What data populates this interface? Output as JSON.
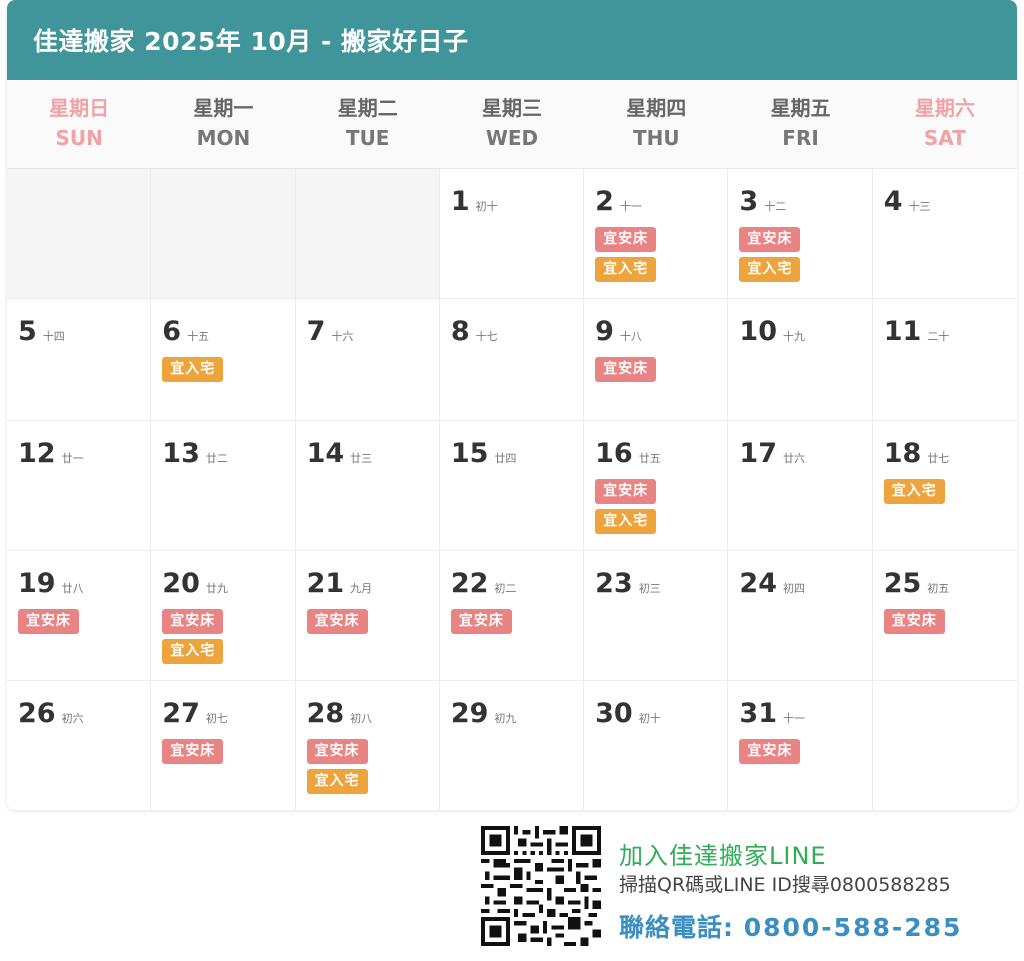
{
  "header": {
    "title": "佳達搬家 2025年 10月 - 搬家好日子"
  },
  "weekdays": [
    {
      "zh": "星期日",
      "en": "SUN",
      "weekend": true
    },
    {
      "zh": "星期一",
      "en": "MON",
      "weekend": false
    },
    {
      "zh": "星期二",
      "en": "TUE",
      "weekend": false
    },
    {
      "zh": "星期三",
      "en": "WED",
      "weekend": false
    },
    {
      "zh": "星期四",
      "en": "THU",
      "weekend": false
    },
    {
      "zh": "星期五",
      "en": "FRI",
      "weekend": false
    },
    {
      "zh": "星期六",
      "en": "SAT",
      "weekend": true
    }
  ],
  "tag_labels": {
    "bed": "宜安床",
    "move": "宜入宅"
  },
  "days": [
    {
      "num": "1",
      "lunar": "初十",
      "tags": []
    },
    {
      "num": "2",
      "lunar": "十一",
      "tags": [
        "bed",
        "move"
      ]
    },
    {
      "num": "3",
      "lunar": "十二",
      "tags": [
        "bed",
        "move"
      ]
    },
    {
      "num": "4",
      "lunar": "十三",
      "tags": []
    },
    {
      "num": "5",
      "lunar": "十四",
      "tags": []
    },
    {
      "num": "6",
      "lunar": "十五",
      "tags": [
        "move"
      ]
    },
    {
      "num": "7",
      "lunar": "十六",
      "tags": []
    },
    {
      "num": "8",
      "lunar": "十七",
      "tags": []
    },
    {
      "num": "9",
      "lunar": "十八",
      "tags": [
        "bed"
      ]
    },
    {
      "num": "10",
      "lunar": "十九",
      "tags": []
    },
    {
      "num": "11",
      "lunar": "二十",
      "tags": []
    },
    {
      "num": "12",
      "lunar": "廿一",
      "tags": []
    },
    {
      "num": "13",
      "lunar": "廿二",
      "tags": []
    },
    {
      "num": "14",
      "lunar": "廿三",
      "tags": []
    },
    {
      "num": "15",
      "lunar": "廿四",
      "tags": []
    },
    {
      "num": "16",
      "lunar": "廿五",
      "tags": [
        "bed",
        "move"
      ]
    },
    {
      "num": "17",
      "lunar": "廿六",
      "tags": []
    },
    {
      "num": "18",
      "lunar": "廿七",
      "tags": [
        "move"
      ]
    },
    {
      "num": "19",
      "lunar": "廿八",
      "tags": [
        "bed"
      ]
    },
    {
      "num": "20",
      "lunar": "廿九",
      "tags": [
        "bed",
        "move"
      ]
    },
    {
      "num": "21",
      "lunar": "九月",
      "tags": [
        "bed"
      ]
    },
    {
      "num": "22",
      "lunar": "初二",
      "tags": [
        "bed"
      ]
    },
    {
      "num": "23",
      "lunar": "初三",
      "tags": []
    },
    {
      "num": "24",
      "lunar": "初四",
      "tags": []
    },
    {
      "num": "25",
      "lunar": "初五",
      "tags": [
        "bed"
      ]
    },
    {
      "num": "26",
      "lunar": "初六",
      "tags": []
    },
    {
      "num": "27",
      "lunar": "初七",
      "tags": [
        "bed"
      ]
    },
    {
      "num": "28",
      "lunar": "初八",
      "tags": [
        "bed",
        "move"
      ]
    },
    {
      "num": "29",
      "lunar": "初九",
      "tags": []
    },
    {
      "num": "30",
      "lunar": "初十",
      "tags": []
    },
    {
      "num": "31",
      "lunar": "十一",
      "tags": [
        "bed"
      ]
    }
  ],
  "footer": {
    "line_title": "加入佳達搬家LINE",
    "line_sub": "掃描QR碼或LINE ID搜尋0800588285",
    "phone_label": "聯絡電話:",
    "phone_number": "0800-588-285",
    "qr_icon": "qr-code-icon",
    "colors": {
      "line_green": "#2fae55",
      "phone_blue": "#3a8fc2"
    }
  },
  "colors": {
    "header_bg": "#3f9599",
    "weekend": "#f0a2a6",
    "tag_bed": "#e98484",
    "tag_move": "#eda43d"
  }
}
